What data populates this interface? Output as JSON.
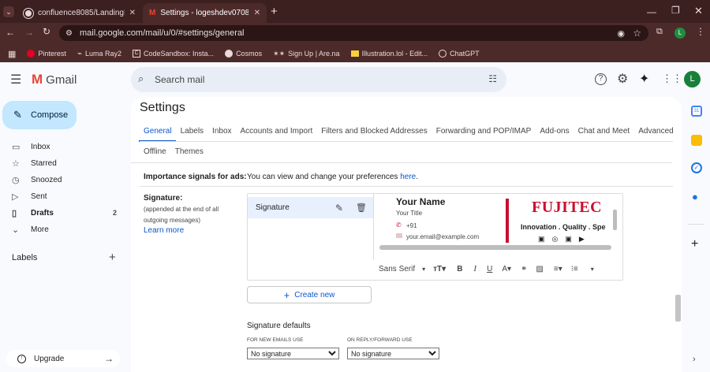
{
  "browser": {
    "tabs": [
      {
        "title": "confluence8085/LandingPage/"
      },
      {
        "title": "Settings - logeshdev0708@gm"
      }
    ],
    "new_tab": "+",
    "url": "mail.google.com/mail/u/0/#settings/general",
    "profile_initial": "L",
    "bookmarks": [
      {
        "label": "Pinterest",
        "icon": "pinterest-icon"
      },
      {
        "label": "Luma Ray2",
        "icon": "luma-icon"
      },
      {
        "label": "CodeSandbox: Insta...",
        "icon": "codesandbox-icon"
      },
      {
        "label": "Cosmos",
        "icon": "cosmos-icon"
      },
      {
        "label": "Sign Up | Are.na",
        "icon": "arena-icon"
      },
      {
        "label": "Illustration.lol - Edit...",
        "icon": "illustration-icon"
      },
      {
        "label": "ChatGPT",
        "icon": "chatgpt-icon"
      }
    ]
  },
  "gmail": {
    "logo_text": "Gmail",
    "search_placeholder": "Search mail",
    "avatar_initial": "L",
    "compose_label": "Compose",
    "nav": [
      {
        "label": "Inbox",
        "icon": "inbox-icon",
        "count": ""
      },
      {
        "label": "Starred",
        "icon": "star-icon",
        "count": ""
      },
      {
        "label": "Snoozed",
        "icon": "clock-icon",
        "count": ""
      },
      {
        "label": "Sent",
        "icon": "send-icon",
        "count": ""
      },
      {
        "label": "Drafts",
        "icon": "draft-icon",
        "count": "2"
      },
      {
        "label": "More",
        "icon": "chevron-down-icon",
        "count": ""
      }
    ],
    "labels_title": "Labels",
    "upgrade_label": "Upgrade"
  },
  "settings": {
    "title": "Settings",
    "tabs": [
      "General",
      "Labels",
      "Inbox",
      "Accounts and Import",
      "Filters and Blocked Addresses",
      "Forwarding and POP/IMAP",
      "Add-ons",
      "Chat and Meet",
      "Advanced"
    ],
    "tabs_row2": [
      "Offline",
      "Themes"
    ],
    "importance_label": "Importance signals for ads:",
    "importance_text": "You can view and change your preferences ",
    "importance_link": "here",
    "importance_suffix": ".",
    "signature_label": "Signature:",
    "signature_note": "(appended at the end of all outgoing messages)",
    "learn_more": "Learn more",
    "signature_item": "Signature",
    "sig_preview": {
      "name": "Your Name",
      "title": "Your Title",
      "phone": "+91",
      "email": "your.email@example.com",
      "brand": "FUJITEC",
      "tagline": "Innovation . Quality . Spe"
    },
    "editor": {
      "font": "Sans Serif"
    },
    "create_new": "Create new",
    "defaults_title": "Signature defaults",
    "new_emails_label": "FOR NEW EMAILS USE",
    "reply_label": "ON REPLY/FORWARD USE",
    "new_emails_value": "No signature",
    "reply_value": "No signature"
  },
  "colors": {
    "accent": "#0b57d0",
    "compose_bg": "#c2e7ff",
    "brand_red": "#c8102e",
    "chrome_dark": "#3c1f1f"
  }
}
